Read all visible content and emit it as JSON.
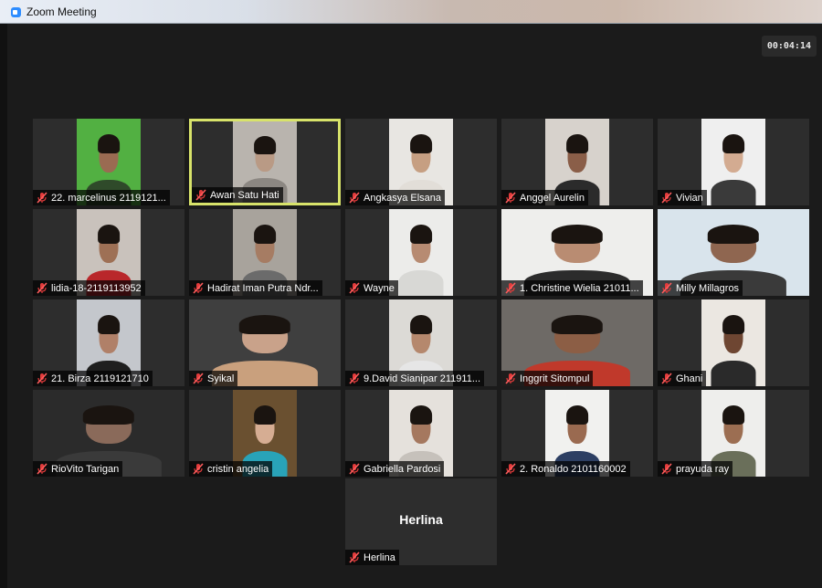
{
  "window": {
    "title": "Zoom Meeting",
    "icon": "zoom-app-icon"
  },
  "meeting": {
    "timer": "00:04:14",
    "muted_icon": "muted-microphone-icon",
    "accent_color": "#d8e36a"
  },
  "participants": [
    {
      "name": "22. marcelinus 2119121...",
      "bg": "#52b042",
      "skin": "#9a6b52",
      "shirt": "#2f4a2a"
    },
    {
      "name": "Awan Satu Hati",
      "bg": "#b9b4ae",
      "skin": "#b99a85",
      "shirt": "#8c8782"
    },
    {
      "name": "Angkasya Elsana",
      "bg": "#e8e6e2",
      "skin": "#c69f82",
      "shirt": "#e2ded8"
    },
    {
      "name": "Anggel Aurelin",
      "bg": "#d7d2cc",
      "skin": "#8a5e48",
      "shirt": "#2b2b2b"
    },
    {
      "name": "Vivian",
      "bg": "#efefef",
      "skin": "#d3ab91",
      "shirt": "#3a3a3a"
    },
    {
      "name": "lidia-18-2119113952",
      "bg": "#c9c2bc",
      "skin": "#9e7055",
      "shirt": "#b9272b"
    },
    {
      "name": "Hadirat Iman Putra Ndr...",
      "bg": "#a8a39c",
      "skin": "#a67c63",
      "shirt": "#6b6b6b"
    },
    {
      "name": "Wayne",
      "bg": "#ececea",
      "skin": "#b78b72",
      "shirt": "#d8d8d5"
    },
    {
      "name": "1. Christine Wielia 21011...",
      "bg": "#eeeeec",
      "skin": "#b98c72",
      "shirt": "#2c2c2c"
    },
    {
      "name": "Milly Millagros",
      "bg": "#d9e4ec",
      "skin": "#8f6650",
      "shirt": "#3a3a3a"
    },
    {
      "name": "21. Birza 2119121710",
      "bg": "#c4c7cc",
      "skin": "#b08068",
      "shirt": "#1f1f1f"
    },
    {
      "name": "Syikal",
      "bg": "#3f3f3f",
      "skin": "#c9a28a",
      "shirt": "#c9a07d"
    },
    {
      "name": "9.David Sianipar 211911...",
      "bg": "#dcdad6",
      "skin": "#b5886d",
      "shirt": "#e6e6e6"
    },
    {
      "name": "Inggrit Sitompul",
      "bg": "#6e6a66",
      "skin": "#8c5e45",
      "shirt": "#c0392b"
    },
    {
      "name": "Ghani",
      "bg": "#ebe7e1",
      "skin": "#6e4632",
      "shirt": "#2a2a2a"
    },
    {
      "name": "RioVito Tarigan",
      "bg": "#2b2b2b",
      "skin": "#8a6a5a",
      "shirt": "#3a3a3a"
    },
    {
      "name": "cristin angelia",
      "bg": "#6a5030",
      "skin": "#d6ad93",
      "shirt": "#29a3b8"
    },
    {
      "name": "Gabriella Pardosi",
      "bg": "#e5e1dc",
      "skin": "#a5785f",
      "shirt": "#c6c1bb"
    },
    {
      "name": "2. Ronaldo 2101160002",
      "bg": "#f1f1ef",
      "skin": "#9a6a50",
      "shirt": "#2d3f63"
    },
    {
      "name": "prayuda ray",
      "bg": "#eeeeec",
      "skin": "#9c6e52",
      "shirt": "#6a6f5a"
    }
  ],
  "avatar_participant": {
    "display_name": "Herlina",
    "name": "Herlina"
  }
}
